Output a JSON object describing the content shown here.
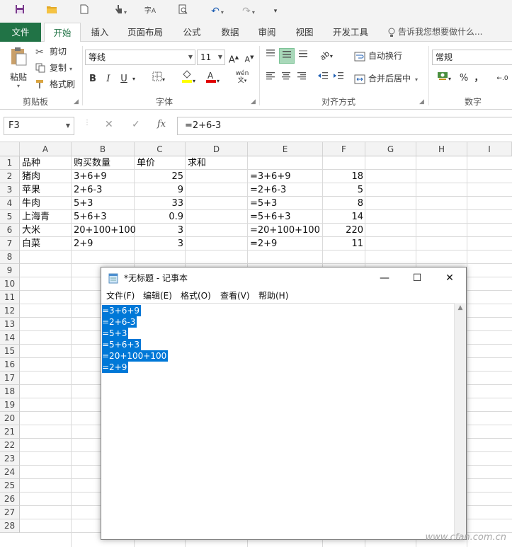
{
  "qat": {
    "undo_arrow": "▾",
    "redo_arrow": "▾"
  },
  "tabs": {
    "file": "文件",
    "items": [
      "开始",
      "插入",
      "页面布局",
      "公式",
      "数据",
      "审阅",
      "视图",
      "开发工具"
    ],
    "tellme": "告诉我您想要做什么..."
  },
  "ribbon": {
    "clipboard": {
      "paste": "粘贴",
      "cut": "剪切",
      "copy": "复制",
      "format_painter": "格式刷",
      "label": "剪贴板"
    },
    "font": {
      "name": "等线",
      "size": "11",
      "bold": "B",
      "italic": "I",
      "underline": "U",
      "label": "字体",
      "grow": "A",
      "shrink": "A",
      "phonetic": "wén"
    },
    "alignment": {
      "wrap": "自动换行",
      "merge": "合并后居中",
      "label": "对齐方式"
    },
    "number": {
      "format": "常规",
      "percent": "%",
      "comma": "，",
      "label": "数字"
    }
  },
  "formula_bar": {
    "name_box": "F3",
    "fx": "fx",
    "formula": "=2+6-3"
  },
  "grid": {
    "columns": [
      "A",
      "B",
      "C",
      "D",
      "E",
      "F",
      "G",
      "H",
      "I"
    ],
    "rows": [
      "1",
      "2",
      "3",
      "4",
      "5",
      "6",
      "7",
      "8",
      "9",
      "10",
      "11",
      "12",
      "13",
      "14",
      "15",
      "16",
      "17",
      "18",
      "19",
      "20",
      "21",
      "22",
      "23",
      "24",
      "25",
      "26",
      "27",
      "28"
    ],
    "cells": {
      "A1": "品种",
      "B1": "购买数量",
      "C1": "单价",
      "D1": "求和",
      "A2": "猪肉",
      "B2": "3+6+9",
      "C2": "25",
      "E2": "=3+6+9",
      "F2": "18",
      "A3": "苹果",
      "B3": "2+6-3",
      "C3": "9",
      "E3": "=2+6-3",
      "F3": "5",
      "A4": "牛肉",
      "B4": "5+3",
      "C4": "33",
      "E4": "=5+3",
      "F4": "8",
      "A5": "上海青",
      "B5": "5+6+3",
      "C5": "0.9",
      "E5": "=5+6+3",
      "F5": "14",
      "A6": "大米",
      "B6": "20+100+100",
      "C6": "3",
      "E6": "=20+100+100",
      "F6": "220",
      "A7": "白菜",
      "B7": "2+9",
      "C7": "3",
      "E7": "=2+9",
      "F7": "11"
    }
  },
  "notepad": {
    "title": "*无标题 - 记事本",
    "menu": [
      "文件(F)",
      "编辑(E)",
      "格式(O)",
      "查看(V)",
      "帮助(H)"
    ],
    "lines": [
      "=3+6+9",
      "=2+6-3",
      "=5+3",
      "=5+6+3",
      "=20+100+100",
      "=2+9"
    ],
    "minimize": "—",
    "maximize": "☐",
    "close": "✕"
  },
  "watermark": "www.cfan.com.cn",
  "colors": {
    "excel_green": "#217346",
    "selection": "#0078d7"
  }
}
